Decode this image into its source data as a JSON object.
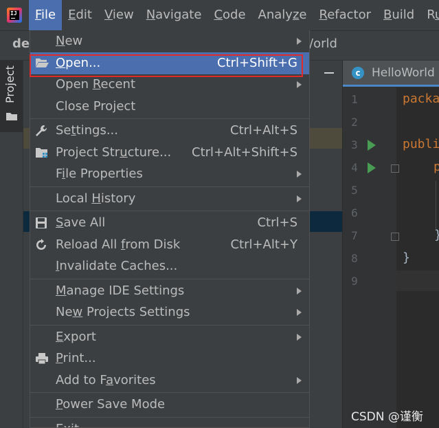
{
  "menubar": {
    "items": [
      {
        "label": "File",
        "mnemonic": "F",
        "active": true
      },
      {
        "label": "Edit",
        "mnemonic": "E"
      },
      {
        "label": "View",
        "mnemonic": "V"
      },
      {
        "label": "Navigate",
        "mnemonic": "N"
      },
      {
        "label": "Code",
        "mnemonic": "C"
      },
      {
        "label": "Analyze",
        "mnemonic": "z"
      },
      {
        "label": "Refactor",
        "mnemonic": "R"
      },
      {
        "label": "Build",
        "mnemonic": "B"
      },
      {
        "label": "Ru",
        "mnemonic": "u"
      }
    ]
  },
  "navbar": {
    "project": "de",
    "file": "/orld"
  },
  "sidebar": {
    "project_tab": "Project"
  },
  "editor": {
    "tab_icon_letter": "c",
    "tab_name": "HelloWorld",
    "line_numbers": [
      "1",
      "2",
      "3",
      "4",
      "5",
      "6",
      "7",
      "8",
      "9"
    ],
    "code_lines": [
      {
        "line": 1,
        "text": "packa",
        "kind": "keyword"
      },
      {
        "line": 3,
        "text": "publi",
        "kind": "keyword"
      },
      {
        "line": 4,
        "text": "p",
        "kind": "keyword"
      },
      {
        "line": 7,
        "text": "}",
        "kind": "plain"
      },
      {
        "line": 8,
        "text": "}",
        "kind": "plain"
      }
    ]
  },
  "file_menu": {
    "items": [
      {
        "label": "New",
        "mnemonic": "N",
        "submenu": true
      },
      {
        "label": "Open...",
        "mnemonic": "O",
        "shortcut": "Ctrl+Shift+G",
        "icon": "open-folder-icon",
        "selected": true,
        "annotated": true
      },
      {
        "label": "Open Recent",
        "mnemonic": "R",
        "submenu": true
      },
      {
        "label": "Close Project",
        "mnemonic": "j"
      },
      {
        "separator": true
      },
      {
        "label": "Settings...",
        "mnemonic": "t",
        "shortcut": "Ctrl+Alt+S",
        "icon": "wrench-icon"
      },
      {
        "label": "Project Structure...",
        "mnemonic": "u",
        "shortcut": "Ctrl+Alt+Shift+S",
        "icon": "project-structure-icon"
      },
      {
        "label": "File Properties",
        "mnemonic": "i",
        "submenu": true
      },
      {
        "separator": true
      },
      {
        "label": "Local History",
        "mnemonic": "H",
        "submenu": true
      },
      {
        "separator": true
      },
      {
        "label": "Save All",
        "mnemonic": "S",
        "shortcut": "Ctrl+S",
        "icon": "save-icon"
      },
      {
        "label": "Reload All from Disk",
        "mnemonic": "f",
        "shortcut": "Ctrl+Alt+Y",
        "icon": "reload-icon"
      },
      {
        "label": "Invalidate Caches...",
        "mnemonic": "I"
      },
      {
        "separator": true
      },
      {
        "label": "Manage IDE Settings",
        "mnemonic": "M",
        "submenu": true
      },
      {
        "label": "New Projects Settings",
        "mnemonic": "w",
        "submenu": true
      },
      {
        "separator": true
      },
      {
        "label": "Export",
        "mnemonic": "E",
        "submenu": true
      },
      {
        "label": "Print...",
        "mnemonic": "P",
        "icon": "print-icon"
      },
      {
        "label": "Add to Favorites",
        "mnemonic": "a",
        "submenu": true
      },
      {
        "separator": true
      },
      {
        "label": "Power Save Mode",
        "mnemonic": "P"
      },
      {
        "separator": true
      },
      {
        "label": "Exit",
        "mnemonic": "x"
      }
    ]
  },
  "colors": {
    "menu_bg": "#3c3f41",
    "selection": "#4b6eaf",
    "annotation_box": "#e12a2a",
    "editor_bg": "#2b2b2b",
    "keyword": "#cc7832"
  },
  "watermark": "CSDN @谨衡"
}
